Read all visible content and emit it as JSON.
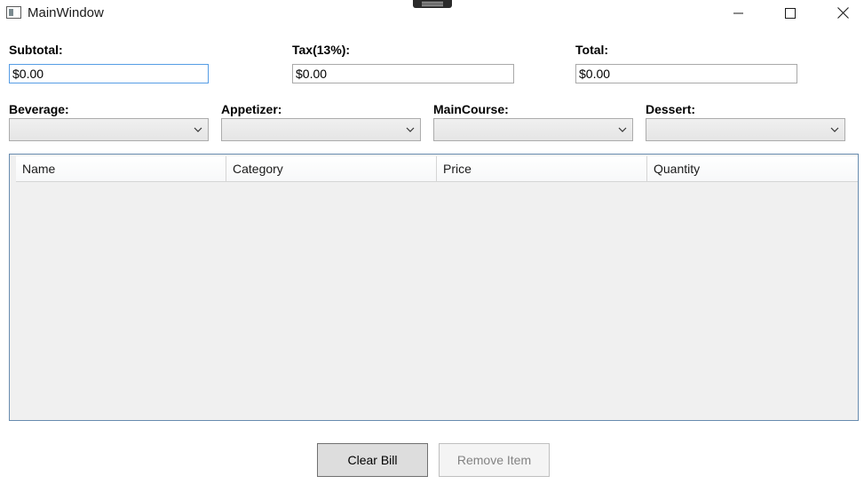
{
  "window": {
    "title": "MainWindow"
  },
  "totals": {
    "subtotal_label": "Subtotal:",
    "subtotal_value": "$0.00",
    "tax_label": "Tax(13%):",
    "tax_value": "$0.00",
    "total_label": "Total:",
    "total_value": "$0.00"
  },
  "menu": {
    "beverage_label": "Beverage:",
    "beverage_value": "",
    "appetizer_label": "Appetizer:",
    "appetizer_value": "",
    "maincourse_label": "MainCourse:",
    "maincourse_value": "",
    "dessert_label": "Dessert:",
    "dessert_value": ""
  },
  "grid": {
    "columns": [
      "Name",
      "Category",
      "Price",
      "Quantity"
    ],
    "rows": []
  },
  "buttons": {
    "clear_bill": "Clear Bill",
    "remove_item": "Remove Item"
  },
  "icons": {
    "app": "window-app-icon",
    "minimize": "minimize-icon",
    "maximize": "maximize-icon",
    "close": "close-icon",
    "dropdown": "chevron-down-icon"
  },
  "colors": {
    "grid_border": "#688caf",
    "focused_input_border": "#569de5",
    "grid_background": "#f0f0f0"
  }
}
